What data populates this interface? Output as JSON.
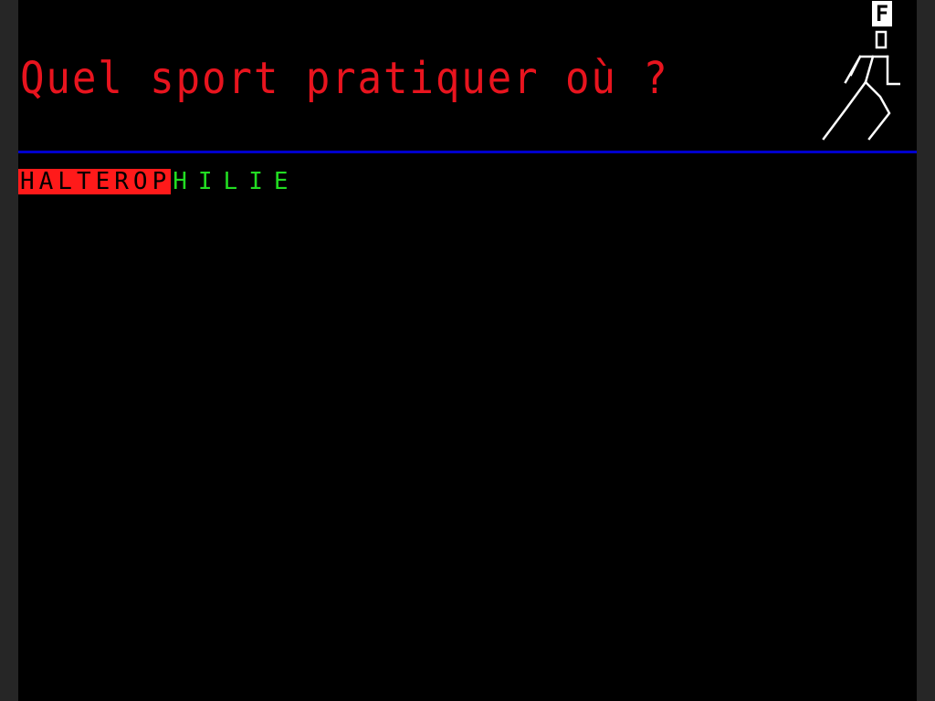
{
  "header": {
    "title": "Quel sport pratiquer où ?"
  },
  "search": {
    "typed_text": "HALTEROP",
    "suggestion_text": "HILIE"
  },
  "logo": {
    "letter": "F",
    "icon": "running-figure-icon"
  },
  "colors": {
    "background": "#000000",
    "title": "#e8141e",
    "separator": "#0000cc",
    "typed_highlight": "#ff1a1a",
    "suggestion": "#22dd22",
    "logo": "#ffffff"
  }
}
